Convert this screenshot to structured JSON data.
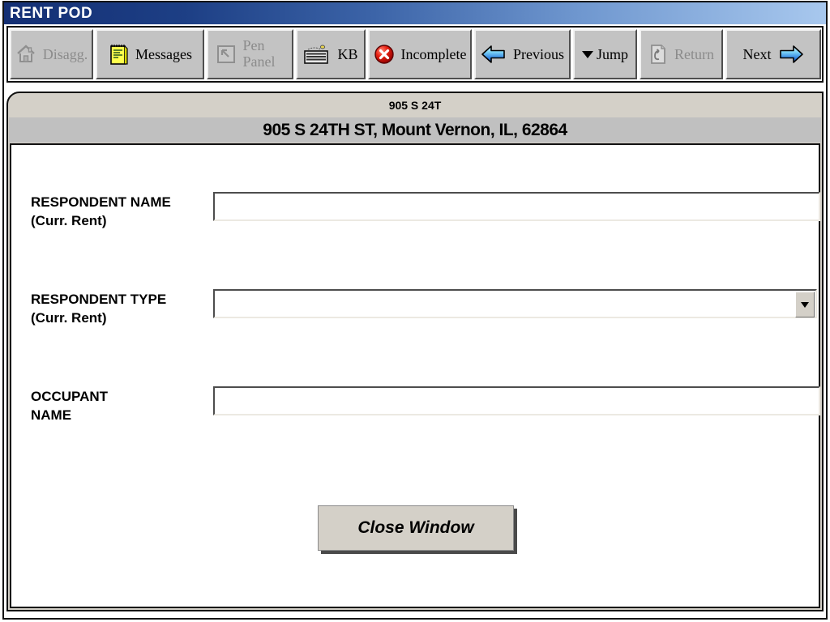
{
  "window": {
    "title": "RENT POD"
  },
  "toolbar": {
    "buttons": [
      {
        "label": "Disagg.",
        "icon": "house-icon",
        "disabled": true
      },
      {
        "label": "Messages",
        "icon": "notepad-icon",
        "disabled": false
      },
      {
        "label": "Pen Panel",
        "icon": "pen-panel-icon",
        "disabled": true
      },
      {
        "label": "KB",
        "icon": "keyboard-icon",
        "disabled": false
      },
      {
        "label": "Incomplete",
        "icon": "incomplete-icon",
        "disabled": false
      },
      {
        "label": "Previous",
        "icon": "arrow-left-icon",
        "disabled": false
      },
      {
        "label": "Jump",
        "icon": "caret-down-icon",
        "disabled": false
      },
      {
        "label": "Return",
        "icon": "return-icon",
        "disabled": true
      },
      {
        "label": "Next",
        "icon": "arrow-right-icon",
        "disabled": false
      }
    ]
  },
  "header": {
    "pod_title": "905 S 24T",
    "address": "905 S 24TH ST, Mount Vernon, IL, 62864"
  },
  "form": {
    "fields": [
      {
        "label_line1": "RESPONDENT NAME",
        "label_line2": "(Curr. Rent)",
        "control": "text",
        "value": ""
      },
      {
        "label_line1": "RESPONDENT TYPE",
        "label_line2": "(Curr. Rent)",
        "control": "dropdown",
        "value": ""
      },
      {
        "label_line1": "OCCUPANT",
        "label_line2": "NAME",
        "control": "text",
        "value": ""
      }
    ],
    "close_button_label": "Close Window"
  },
  "colors": {
    "titlebar_gradient_start": "#142f74",
    "titlebar_gradient_end": "#a8c8ee",
    "toolbar_button_face": "#c3c3c3",
    "panel_face": "#d4d0c8",
    "address_bar": "#c0c0c0",
    "incomplete_red": "#d40000",
    "notepad_yellow": "#ffff4d",
    "arrow_blue": "#2f7fe0",
    "disabled_text": "#8b8b8b"
  }
}
